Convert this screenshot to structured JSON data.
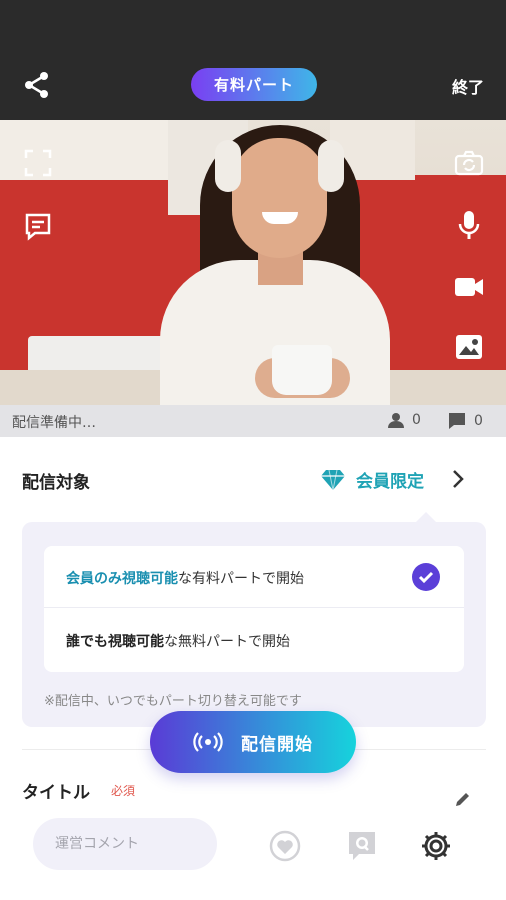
{
  "header": {
    "paid_part_label": "有料パート",
    "end_label": "終了"
  },
  "status": {
    "text": "配信準備中…",
    "viewer_count": "0",
    "comment_count": "0"
  },
  "target": {
    "label": "配信対象",
    "value": "会員限定"
  },
  "options": [
    {
      "highlight": "会員のみ視聴可能",
      "rest": "な有料パートで開始",
      "selected": true
    },
    {
      "highlight": "誰でも視聴可能",
      "rest": "な無料パートで開始",
      "selected": false
    }
  ],
  "note": "※配信中、いつでもパート切り替え可能です",
  "start_button": {
    "label": "配信開始"
  },
  "title_section": {
    "label": "タイトル",
    "required": "必須"
  },
  "bottom_bar": {
    "comment_placeholder": "運営コメント"
  },
  "colors": {
    "accent_teal": "#1fa3b5",
    "accent_purple": "#5b3fd8",
    "header_bg": "#2b2b2b",
    "required_red": "#e0584e"
  }
}
